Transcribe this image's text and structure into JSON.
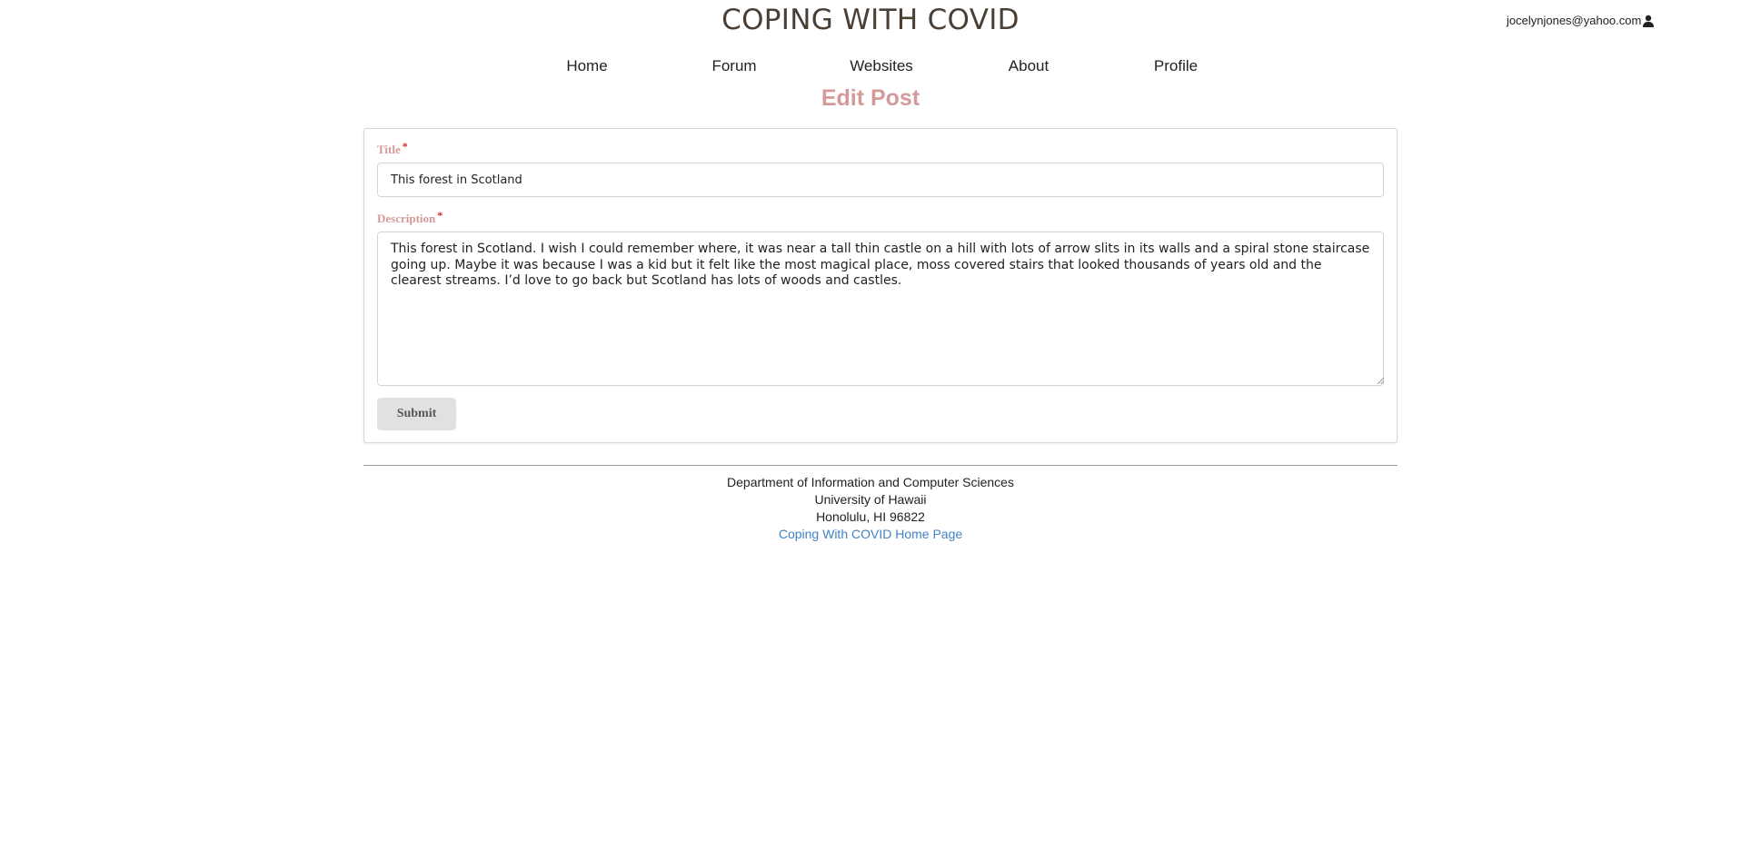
{
  "header": {
    "site_title": "COPING WITH COVID",
    "user_email": "jocelynjones@yahoo.com",
    "user_icon": "user-icon"
  },
  "nav": {
    "items": [
      "Home",
      "Forum",
      "Websites",
      "About",
      "Profile"
    ]
  },
  "page": {
    "heading": "Edit Post"
  },
  "form": {
    "title_label": "Title",
    "title_value": "This forest in Scotland",
    "description_label": "Description",
    "description_value": "This forest in Scotland. I wish I could remember where, it was near a tall thin castle on a hill with lots of arrow slits in its walls and a spiral stone staircase going up. Maybe it was because I was a kid but it felt like the most magical place, moss covered stairs that looked thousands of years old and the clearest streams. I’d love to go back but Scotland has lots of woods and castles.",
    "required_marker": "*",
    "submit_label": "Submit"
  },
  "footer": {
    "line1": "Department of Information and Computer Sciences",
    "line2": "University of Hawaii",
    "line3": "Honolulu, HI 96822",
    "link_text": "Coping With COVID Home Page"
  },
  "colors": {
    "accent_pink": "#d49a9a",
    "link_blue": "#4183c4",
    "required_red": "#db2828",
    "title_brown": "#4a3f35"
  }
}
